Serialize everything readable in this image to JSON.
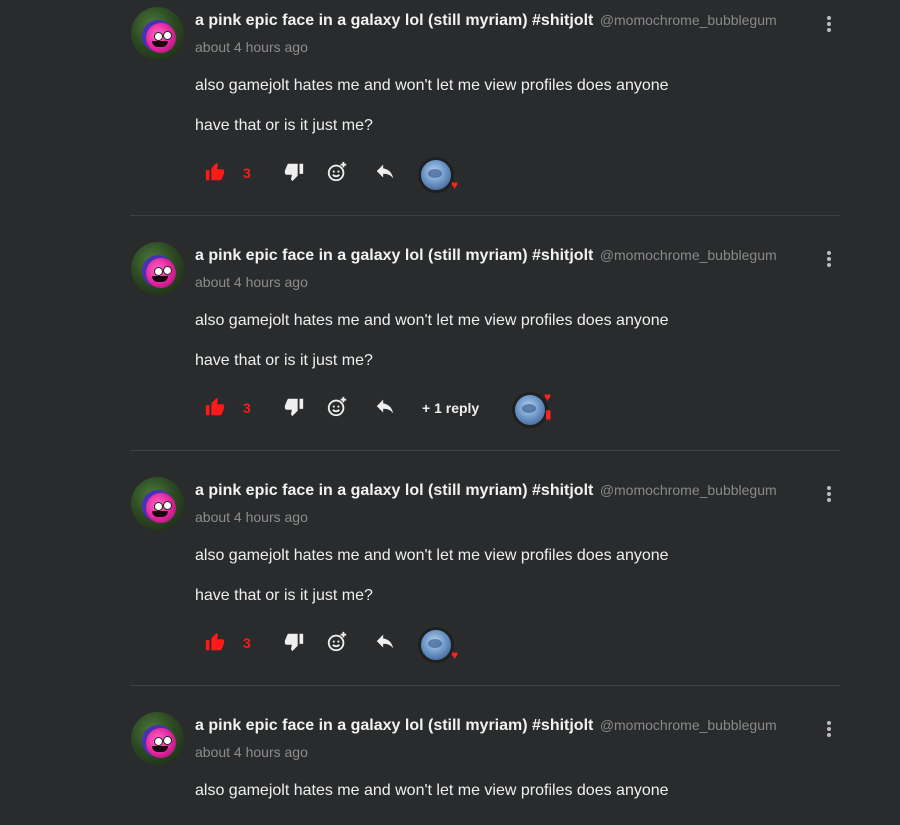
{
  "comments": [
    {
      "username": "a pink epic face in a galaxy lol (still myriam) #shitjolt",
      "handle": "@momochrome_bubblegum",
      "timestamp": "about 4 hours ago",
      "paragraphs": [
        "also gamejolt hates me and won't let me view profiles does anyone",
        "have that or is it just me?"
      ],
      "like_count": "3",
      "replies_label": ""
    },
    {
      "username": "a pink epic face in a galaxy lol (still myriam) #shitjolt",
      "handle": "@momochrome_bubblegum",
      "timestamp": "about 4 hours ago",
      "paragraphs": [
        "also gamejolt hates me and won't let me view profiles does anyone",
        "have that or is it just me?"
      ],
      "like_count": "3",
      "replies_label": "+ 1 reply"
    },
    {
      "username": "a pink epic face in a galaxy lol (still myriam) #shitjolt",
      "handle": "@momochrome_bubblegum",
      "timestamp": "about 4 hours ago",
      "paragraphs": [
        "also gamejolt hates me and won't let me view profiles does anyone",
        "have that or is it just me?"
      ],
      "like_count": "3",
      "replies_label": ""
    },
    {
      "username": "a pink epic face in a galaxy lol (still myriam) #shitjolt",
      "handle": "@momochrome_bubblegum",
      "timestamp": "about 4 hours ago",
      "paragraphs": [
        "also gamejolt hates me and won't let me view profiles does anyone"
      ],
      "like_count": "",
      "replies_label": ""
    }
  ],
  "colors": {
    "background": "#292b2c",
    "like_red": "#ff1a1a",
    "muted_text": "#8d8d8d"
  },
  "icons": {
    "like": "thumbs-up-icon",
    "dislike": "thumbs-down-icon",
    "react": "add-reaction-icon",
    "reply": "reply-arrow-icon",
    "more": "more-vertical-icon",
    "heart": "heart-icon"
  }
}
